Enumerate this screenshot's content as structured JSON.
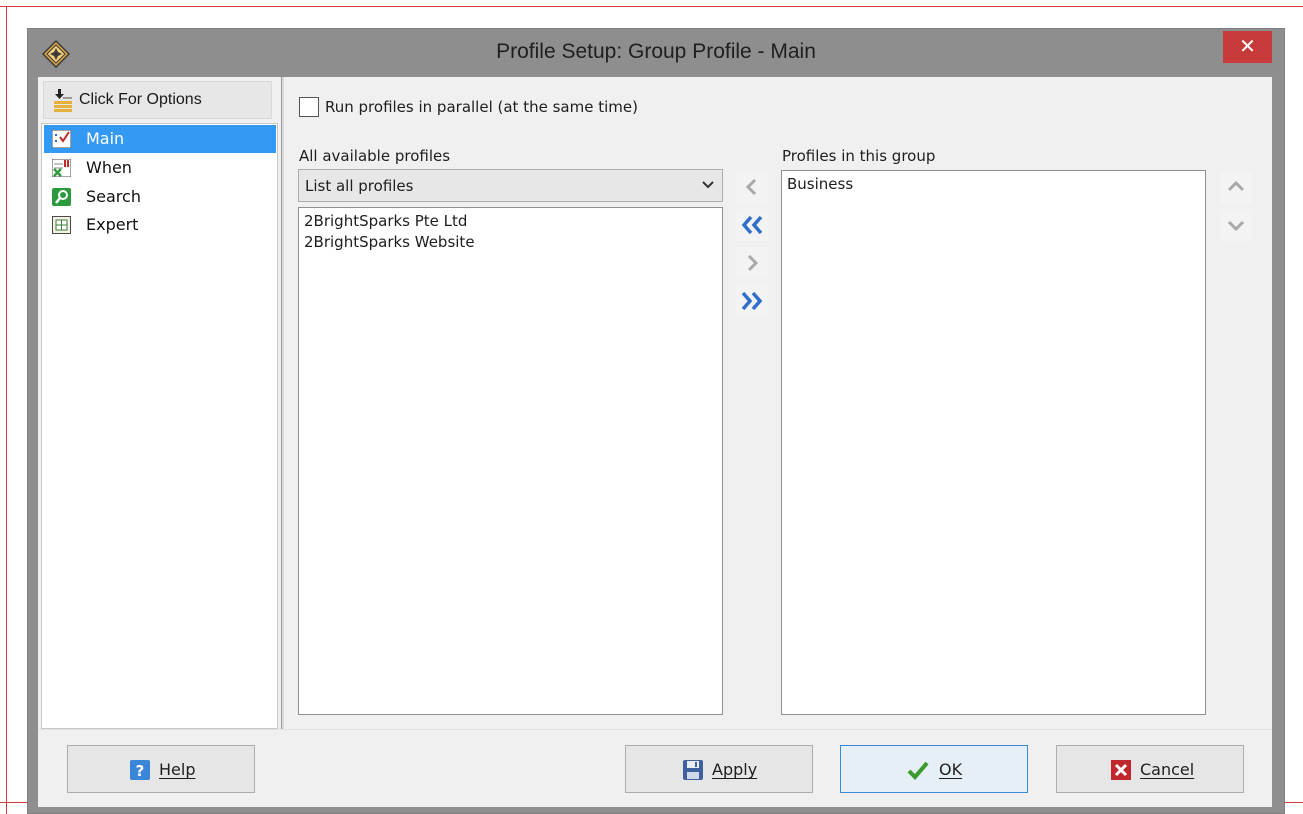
{
  "window": {
    "title": "Profile Setup: Group Profile - Main",
    "close_glyph": "✕"
  },
  "sidebar": {
    "options_label": "Click For Options",
    "items": [
      {
        "label": "Main",
        "icon": "main-checklist-icon",
        "selected": true
      },
      {
        "label": "When",
        "icon": "when-schedule-icon",
        "selected": false
      },
      {
        "label": "Search",
        "icon": "search-magnifier-icon",
        "selected": false
      },
      {
        "label": "Expert",
        "icon": "expert-grid-icon",
        "selected": false
      }
    ]
  },
  "main": {
    "parallel_checkbox": {
      "label": "Run profiles in parallel (at the same time)",
      "checked": false
    },
    "available": {
      "label": "All available profiles",
      "filter_value": "List all profiles",
      "items": [
        "2BrightSparks Pte Ltd",
        "2BrightSparks Website"
      ]
    },
    "group": {
      "label": "Profiles in this group",
      "items": [
        "Business"
      ]
    },
    "transfer_buttons": [
      "move-left-icon",
      "move-all-left-icon",
      "move-right-icon",
      "move-all-right-icon"
    ],
    "order_buttons": [
      "move-up-icon",
      "move-down-icon"
    ]
  },
  "footer": {
    "help_label": "Help",
    "apply_label": "Apply",
    "ok_label": "OK",
    "cancel_label": "Cancel"
  },
  "colors": {
    "titlebar": "#8e8e8e",
    "close": "#c73a3a",
    "selection": "#3399f3",
    "arrow_active": "#2f6fc9",
    "arrow_disabled": "#a9a9a9"
  }
}
